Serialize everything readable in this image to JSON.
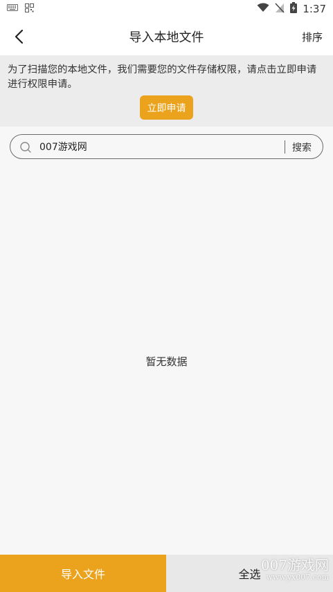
{
  "status_bar": {
    "time": "1:37",
    "icons": [
      "keyboard-icon",
      "qr-icon",
      "wifi-icon",
      "no-sim-icon",
      "battery-charging-icon"
    ]
  },
  "header": {
    "title": "导入本地文件",
    "sort_label": "排序"
  },
  "notice": {
    "text": "为了扫描您的本地文件，我们需要您的文件存储权限，请点击立即申请进行权限申请。",
    "apply_label": "立即申请"
  },
  "search": {
    "value": "007游戏网",
    "button_label": "搜索"
  },
  "empty": {
    "text": "暂无数据"
  },
  "bottom": {
    "import_label": "导入文件",
    "select_all_label": "全选"
  },
  "watermark": {
    "title": "007游戏网",
    "url": "www.yx007.com"
  },
  "colors": {
    "accent": "#eba31e",
    "notice_bg": "#ececec",
    "page_bg": "#f7f7f7"
  }
}
